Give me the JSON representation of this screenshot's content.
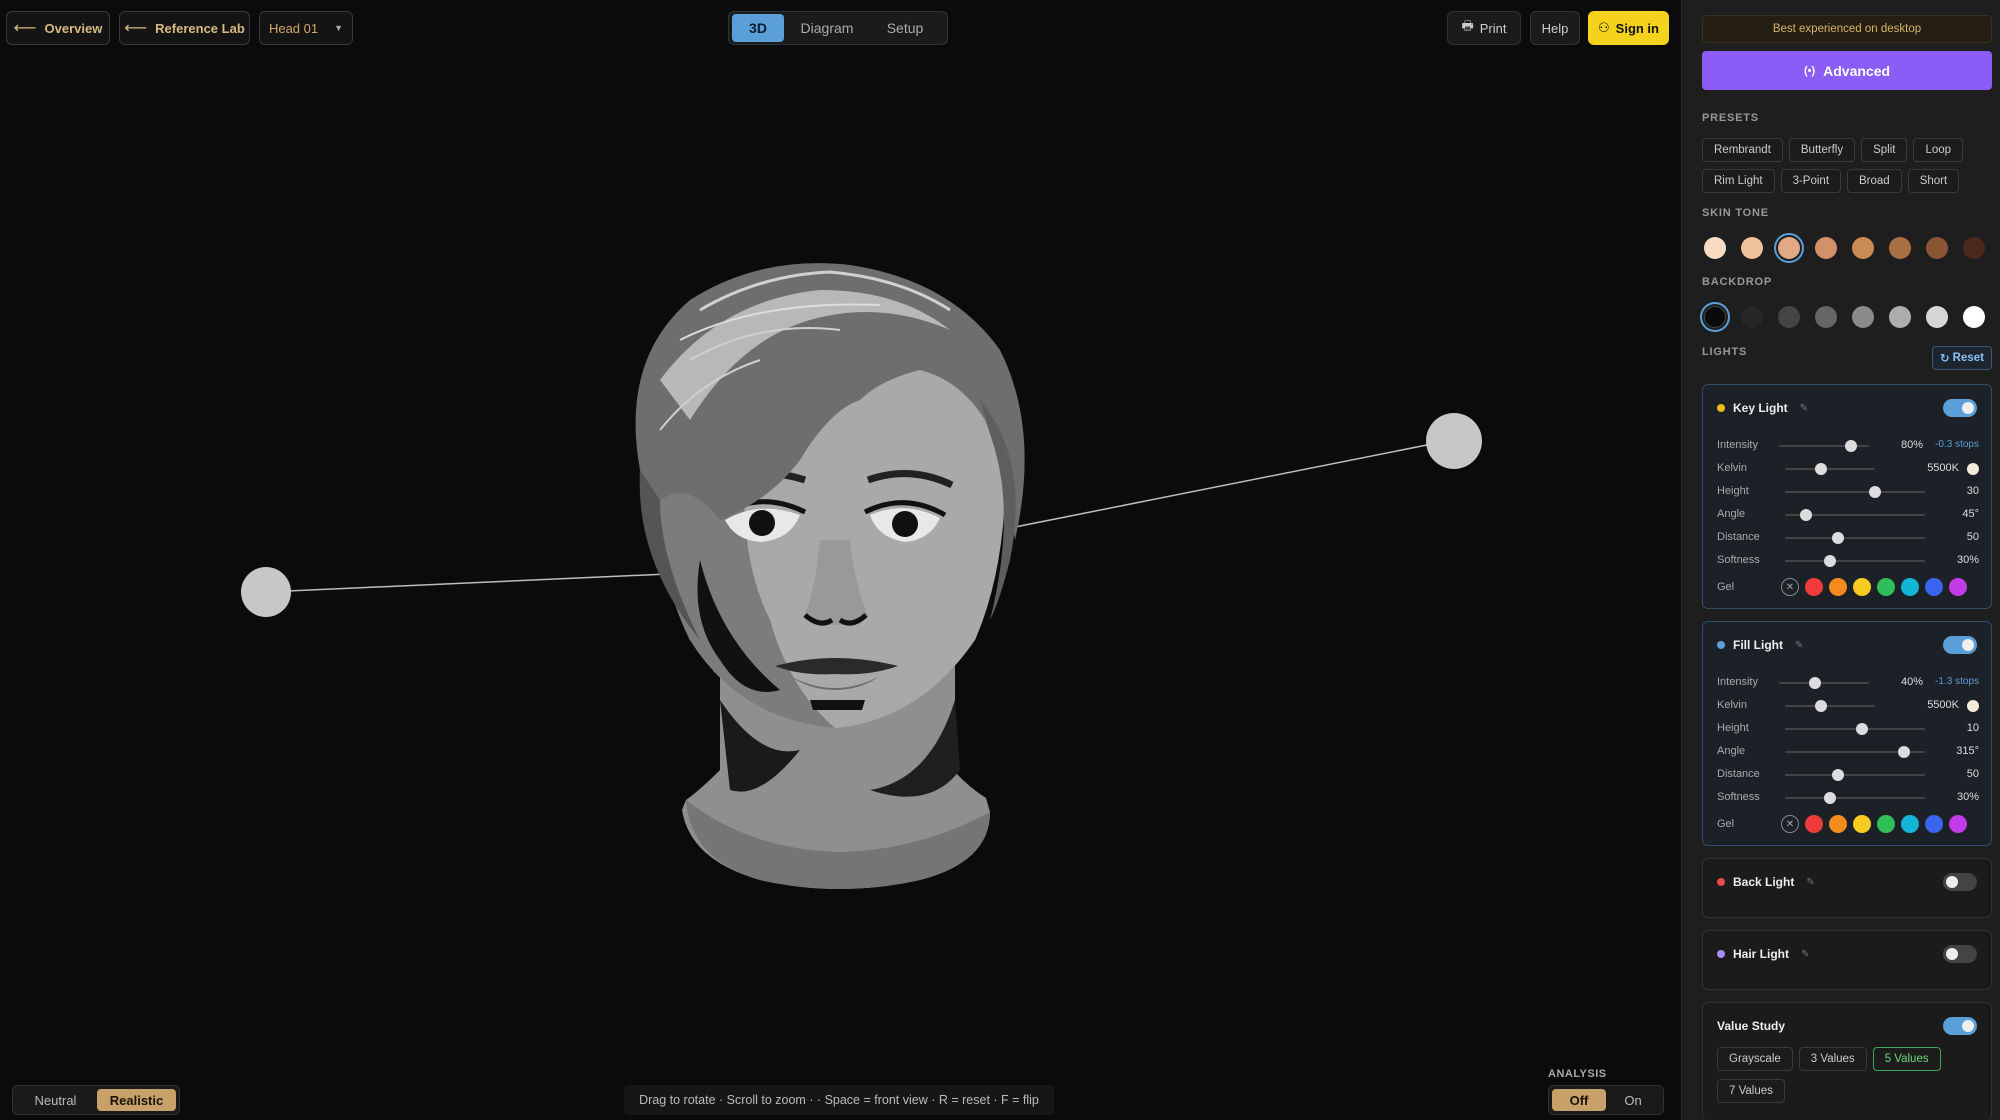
{
  "topbar": {
    "overview": "Overview",
    "reference_lab": "Reference Lab",
    "head_select": "Head 01",
    "view_tabs": [
      "3D",
      "Diagram",
      "Setup"
    ],
    "active_view": "3D",
    "print": "Print",
    "help": "Help",
    "sign_in": "Sign in"
  },
  "bottombar": {
    "modes": [
      "Neutral",
      "Realistic"
    ],
    "active_mode": "Realistic",
    "hint": "Drag to rotate · Scroll to zoom · · Space = front view · R = reset · F = flip",
    "analysis_label": "ANALYSIS",
    "analysis_options": [
      "Off",
      "On"
    ],
    "analysis_active": "Off"
  },
  "panel": {
    "notice": "Best experienced on desktop",
    "advanced": "Advanced",
    "presets_label": "PRESETS",
    "presets_row1": [
      "Rembrandt",
      "Butterfly",
      "Split",
      "Loop"
    ],
    "presets_row2": [
      "Rim Light",
      "3-Point",
      "Broad",
      "Short"
    ],
    "skin_label": "SKIN TONE",
    "skin_tones": [
      "#f7dcc3",
      "#efc39a",
      "#e3a987",
      "#d49068",
      "#c98a55",
      "#a96f44",
      "#8a5535",
      "#4a2a1a"
    ],
    "skin_selected": 2,
    "backdrop_label": "BACKDROP",
    "backdrops": [
      "#0a0a0a",
      "#262626",
      "#454545",
      "#666666",
      "#8a8a8a",
      "#adadad",
      "#d6d6d6",
      "#ffffff"
    ],
    "backdrop_selected": 0,
    "lights_label": "LIGHTS",
    "reset": "Reset",
    "labels": {
      "intensity": "Intensity",
      "kelvin": "Kelvin",
      "height": "Height",
      "angle": "Angle",
      "distance": "Distance",
      "softness": "Softness",
      "gel": "Gel"
    },
    "gel_colors": [
      "#ef3b3b",
      "#f58a1f",
      "#f5cc1f",
      "#2fbf5a",
      "#12b5d6",
      "#3b64f0",
      "#c23be8"
    ],
    "key_light": {
      "name": "Key Light",
      "dot": "#f2b81b",
      "on": true,
      "intensity": "80%",
      "intensity_level": 0.8,
      "stops": "-0.3 stops",
      "kelvin": "5500K",
      "kelvin_level": 0.4,
      "height": "30",
      "height_level": 0.64,
      "angle": "45°",
      "angle_level": 0.15,
      "distance": "50",
      "distance_level": 0.38,
      "softness": "30%",
      "softness_level": 0.32
    },
    "fill_light": {
      "name": "Fill Light",
      "dot": "#5b9fd8",
      "on": true,
      "intensity": "40%",
      "intensity_level": 0.4,
      "stops": "-1.3 stops",
      "kelvin": "5500K",
      "kelvin_level": 0.4,
      "height": "10",
      "height_level": 0.55,
      "angle": "315°",
      "angle_level": 0.85,
      "distance": "50",
      "distance_level": 0.38,
      "softness": "30%",
      "softness_level": 0.32
    },
    "back_light": {
      "name": "Back Light",
      "dot": "#e84b4b",
      "on": false
    },
    "hair_light": {
      "name": "Hair Light",
      "dot": "#a78bfa",
      "on": false
    },
    "value_study": {
      "name": "Value Study",
      "on": true,
      "options_row1": [
        "Grayscale",
        "3 Values",
        "5 Values"
      ],
      "options_row2": [
        "7 Values"
      ],
      "active": "5 Values"
    }
  }
}
